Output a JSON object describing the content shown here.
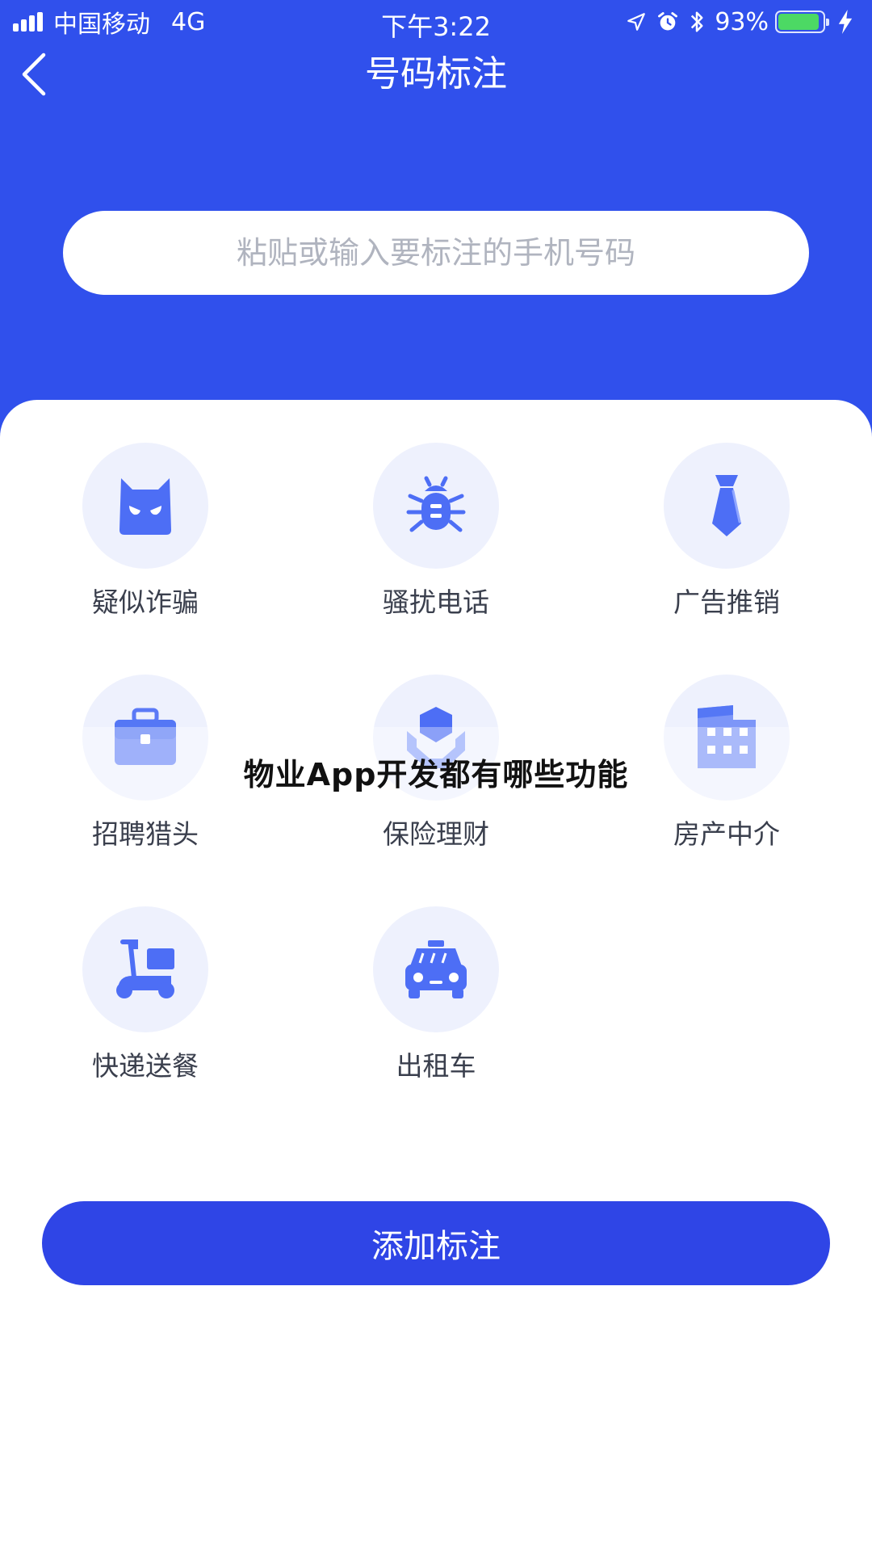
{
  "status_bar": {
    "carrier": "中国移动",
    "network": "4G",
    "time": "下午3:22",
    "battery": "93%",
    "battery_level": 0.93
  },
  "header": {
    "title": "号码标注"
  },
  "search": {
    "placeholder": "粘贴或输入要标注的手机号码"
  },
  "categories": [
    {
      "label": "疑似诈骗",
      "icon": "devil-icon"
    },
    {
      "label": "骚扰电话",
      "icon": "bug-icon"
    },
    {
      "label": "广告推销",
      "icon": "necktie-icon"
    },
    {
      "label": "招聘猎头",
      "icon": "briefcase-icon"
    },
    {
      "label": "保险理财",
      "icon": "shield-hand-icon"
    },
    {
      "label": "房产中介",
      "icon": "building-icon"
    },
    {
      "label": "快递送餐",
      "icon": "scooter-icon"
    },
    {
      "label": "出租车",
      "icon": "taxi-icon"
    }
  ],
  "action": {
    "submit_label": "添加标注"
  },
  "overlay": {
    "watermark": "物业App开发都有哪些功能"
  },
  "colors": {
    "primary": "#3050ec",
    "button": "#2f45e6",
    "icon": "#4d6ef5",
    "icon_bg": "#eef1fd"
  }
}
